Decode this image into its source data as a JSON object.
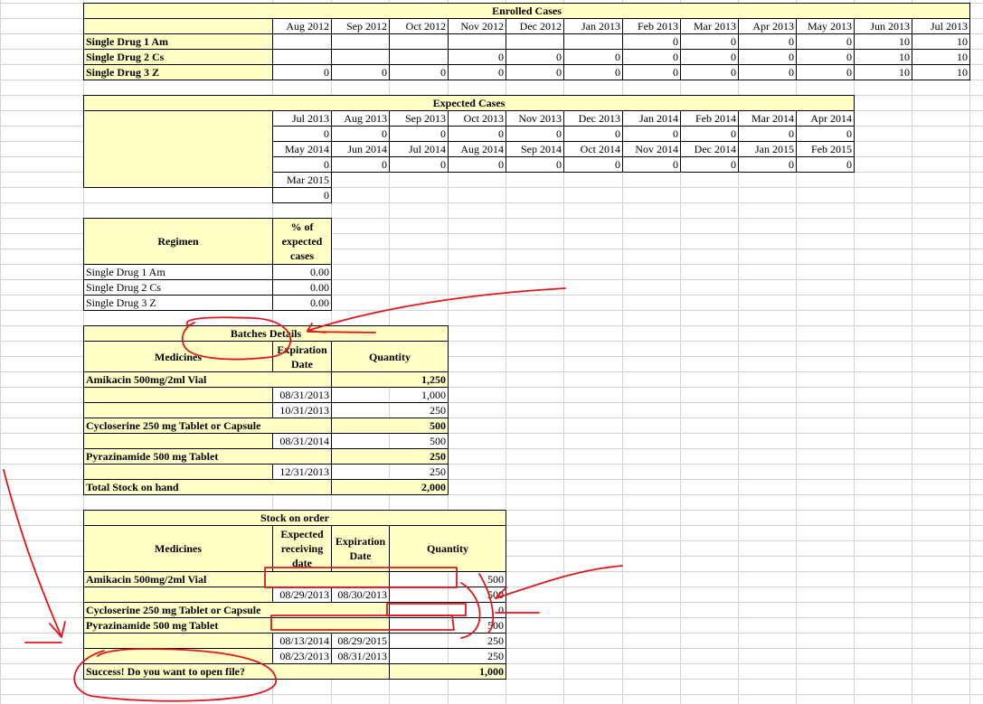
{
  "months_enrolled": [
    "Aug 2012",
    "Sep 2012",
    "Oct 2012",
    "Nov 2012",
    "Dec 2012",
    "Jan 2013",
    "Feb 2013",
    "Mar 2013",
    "Apr 2013",
    "May 2013",
    "Jun 2013",
    "Jul 2013"
  ],
  "enrolled": {
    "title": "Enrolled Cases",
    "rows": [
      {
        "label": "Single Drug 1  Am",
        "values": [
          "",
          "",
          "",
          "",
          "",
          "",
          "0",
          "0",
          "0",
          "0",
          "10",
          "10"
        ]
      },
      {
        "label": "Single Drug 2  Cs",
        "values": [
          "",
          "",
          "",
          "0",
          "0",
          "0",
          "0",
          "0",
          "0",
          "0",
          "10",
          "10"
        ]
      },
      {
        "label": "Single Drug 3  Z",
        "values": [
          "0",
          "0",
          "0",
          "0",
          "0",
          "0",
          "0",
          "0",
          "0",
          "0",
          "10",
          "10"
        ]
      }
    ]
  },
  "expected": {
    "title": "Expected Cases",
    "row1_months": [
      "Jul 2013",
      "Aug 2013",
      "Sep 2013",
      "Oct 2013",
      "Nov 2013",
      "Dec 2013",
      "Jan 2014",
      "Feb 2014",
      "Mar 2014",
      "Apr 2014"
    ],
    "row1_values": [
      "0",
      "0",
      "0",
      "0",
      "0",
      "0",
      "0",
      "0",
      "0",
      "0"
    ],
    "row2_months": [
      "May 2014",
      "Jun 2014",
      "Jul 2014",
      "Aug 2014",
      "Sep 2014",
      "Oct 2014",
      "Nov 2014",
      "Dec 2014",
      "Jan 2015",
      "Feb 2015"
    ],
    "row2_values": [
      "0",
      "0",
      "0",
      "0",
      "0",
      "0",
      "0",
      "0",
      "0",
      "0"
    ],
    "row3_months": [
      "Mar 2015"
    ],
    "row3_values": [
      "0"
    ]
  },
  "regimen": {
    "header_label": "Regimen",
    "header_pct": "% of expected cases",
    "rows": [
      {
        "label": "Single Drug 1  Am",
        "value": "0.00"
      },
      {
        "label": "Single Drug 2  Cs",
        "value": "0.00"
      },
      {
        "label": "Single Drug 3  Z",
        "value": "0.00"
      }
    ]
  },
  "batches": {
    "title": "Batches Details",
    "col_medicines": "Medicines",
    "col_expiration": "Expiration Date",
    "col_quantity": "Quantity",
    "rows": [
      {
        "medicine": "Amikacin  500mg/2ml  Vial",
        "date": "",
        "qty": "1,250",
        "bold": true
      },
      {
        "medicine": "",
        "date": "08/31/2013",
        "qty": "1,000",
        "bold": false
      },
      {
        "medicine": "",
        "date": "10/31/2013",
        "qty": "250",
        "bold": false
      },
      {
        "medicine": "Cycloserine  250 mg  Tablet or Capsule",
        "date": "",
        "qty": "500",
        "bold": true
      },
      {
        "medicine": "",
        "date": "08/31/2014",
        "qty": "500",
        "bold": false
      },
      {
        "medicine": "Pyrazinamide  500 mg  Tablet",
        "date": "",
        "qty": "250",
        "bold": true
      },
      {
        "medicine": "",
        "date": "12/31/2013",
        "qty": "250",
        "bold": false
      }
    ],
    "total_label": "Total Stock on hand",
    "total_value": "2,000"
  },
  "order": {
    "title": "Stock on order",
    "col_medicines": "Medicines",
    "col_expected": "Expected receiving date",
    "col_expiration": "Expiration Date",
    "col_quantity": "Quantity",
    "rows": [
      {
        "medicine": "Amikacin  500mg/2ml  Vial",
        "recv": "",
        "exp": "",
        "qty": "500",
        "bold": true
      },
      {
        "medicine": "",
        "recv": "08/29/2013",
        "exp": "08/30/2013",
        "qty": "500",
        "bold": false
      },
      {
        "medicine": "Cycloserine  250 mg  Tablet or Capsule",
        "recv": "",
        "exp": "",
        "qty": "0",
        "bold": true
      },
      {
        "medicine": "Pyrazinamide  500 mg  Tablet",
        "recv": "",
        "exp": "",
        "qty": "500",
        "bold": true
      },
      {
        "medicine": "",
        "recv": "08/13/2014",
        "exp": "08/29/2015",
        "qty": "250",
        "bold": false
      },
      {
        "medicine": "",
        "recv": "08/23/2013",
        "exp": "08/31/2013",
        "qty": "250",
        "bold": false
      }
    ],
    "total_label": "Success! Do you want to open file?",
    "total_value": "1,000"
  },
  "annotation_color": "#e0161b",
  "grid_color": "#d4d4d4"
}
